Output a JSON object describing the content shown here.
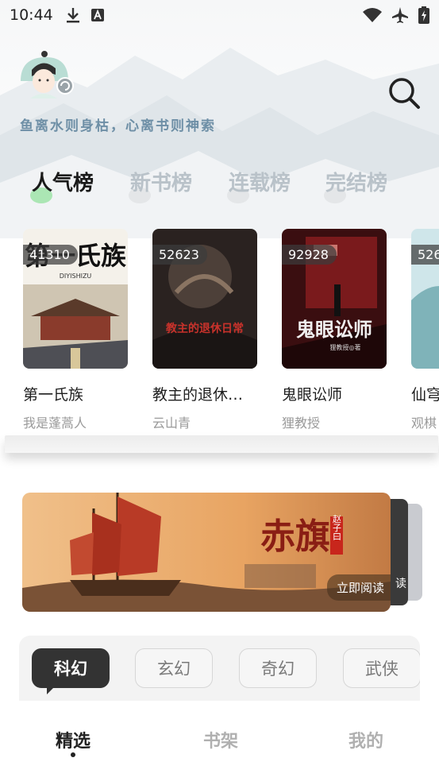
{
  "status_bar": {
    "time": "10:44",
    "left_icons": [
      "download-icon",
      "font-a-icon"
    ],
    "right_icons": [
      "wifi-icon",
      "airplane-icon",
      "battery-charging-icon"
    ]
  },
  "header": {
    "avatar_icon": "avatar-icon",
    "search_icon": "search-icon",
    "slogan": "鱼离水则身枯，心离书则神索"
  },
  "rank_tabs": [
    {
      "label": "人气榜",
      "active": true
    },
    {
      "label": "新书榜",
      "active": false
    },
    {
      "label": "连载榜",
      "active": false
    },
    {
      "label": "完结榜",
      "active": false
    }
  ],
  "books": [
    {
      "count": "41310",
      "title": "第一氏族",
      "author": "我是蓬蒿人",
      "cover_text": "第一氏族",
      "cover_sub": "DIYISHIZU"
    },
    {
      "count": "52623",
      "title": "教主的退休…",
      "author": "云山青",
      "cover_text": "教主的退休日常"
    },
    {
      "count": "92928",
      "title": "鬼眼讼师",
      "author": "狸教授",
      "cover_text": "鬼眼讼师",
      "cover_sub": "狸教授◎著"
    },
    {
      "count": "526",
      "title": "仙穹",
      "author": "观棋"
    }
  ],
  "banner": {
    "title": "赤旗",
    "author_seal": "赵子曰",
    "cta": "立即阅读",
    "back_cta": "读"
  },
  "genres": [
    {
      "label": "科幻",
      "active": true
    },
    {
      "label": "玄幻",
      "active": false
    },
    {
      "label": "奇幻",
      "active": false
    },
    {
      "label": "武侠",
      "active": false
    }
  ],
  "bottom_nav": [
    {
      "label": "精选",
      "active": true
    },
    {
      "label": "书架",
      "active": false
    },
    {
      "label": "我的",
      "active": false
    }
  ],
  "colors": {
    "slogan": "#6e8fa6",
    "tab_inactive": "#b9c2c9",
    "active_chip": "#333333",
    "accent_green": "#7fd68a"
  }
}
